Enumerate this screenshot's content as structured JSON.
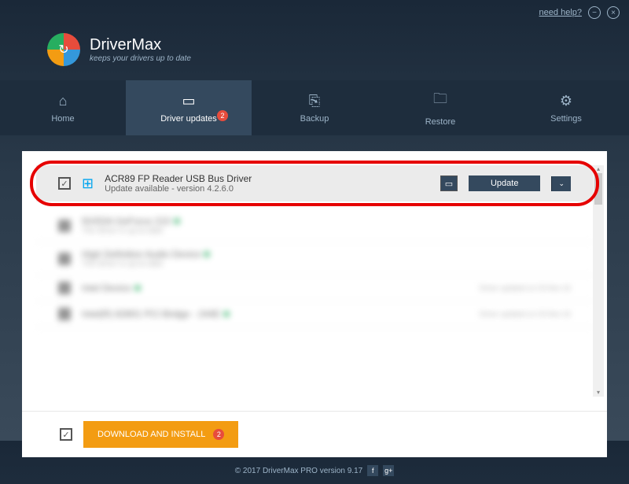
{
  "titlebar": {
    "help_label": "need help?"
  },
  "brand": {
    "name": "DriverMax",
    "tagline": "keeps your drivers up to date"
  },
  "tabs": [
    {
      "label": "Home",
      "icon": "⌂"
    },
    {
      "label": "Driver updates",
      "icon": "▭",
      "badge": "2"
    },
    {
      "label": "Backup",
      "icon": "⎘"
    },
    {
      "label": "Restore",
      "icon": "🗀"
    },
    {
      "label": "Settings",
      "icon": "⚙"
    }
  ],
  "featured_driver": {
    "name": "ACR89 FP Reader USB Bus Driver",
    "status": "Update available - version 4.2.6.0",
    "update_label": "Update"
  },
  "blurred_rows": [
    {
      "title": "NVIDIA GeForce 210",
      "sub": "The driver is up-to-date"
    },
    {
      "title": "High Definition Audio Device",
      "sub": "The driver is up-to-date"
    },
    {
      "title": "Intel Device",
      "sub": "",
      "right": "Driver updated on 03-Nov-16"
    },
    {
      "title": "Intel(R) 82801 PCI Bridge - 244E",
      "sub": "",
      "right": "Driver updated on 03-Nov-16"
    }
  ],
  "download_label": "DOWNLOAD AND INSTALL",
  "download_badge": "2",
  "footer": {
    "copyright": "© 2017 DriverMax PRO version 9.17"
  }
}
